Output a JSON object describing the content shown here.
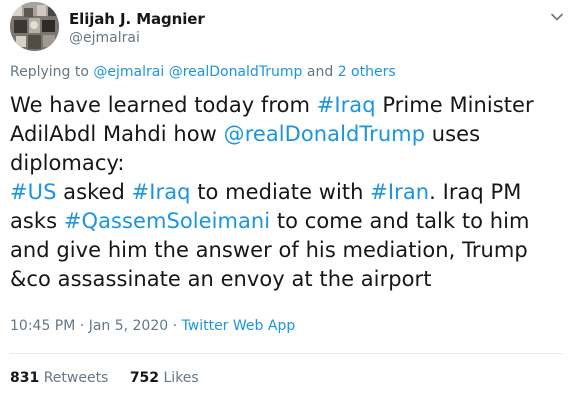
{
  "author": {
    "name": "Elijah J. Magnier",
    "handle": "@ejmalrai"
  },
  "reply_context": {
    "prefix": "Replying to",
    "mention_1": "@ejmalrai",
    "mention_2": "@realDonaldTrump",
    "joiner": "and",
    "others": "2 others"
  },
  "tweet": {
    "t1": "We have learned today from ",
    "h_iraq_1": "#Iraq",
    "t2": " Prime Minister AdilAbdl Mahdi how ",
    "m_trump": "@realDonaldTrump",
    "t3": " uses diplomacy:",
    "h_us": "#US",
    "t4": " asked ",
    "h_iraq_2": "#Iraq",
    "t5": " to mediate with ",
    "h_iran": "#Iran",
    "t6": ". Iraq PM asks ",
    "h_qassem": "#QassemSoleimani",
    "t7": " to come and talk to him and give him the answer of his mediation, Trump &co assassinate an envoy at the airport"
  },
  "meta": {
    "time": "10:45 PM",
    "sep": " · ",
    "date": "Jan 5, 2020",
    "app": "Twitter Web App"
  },
  "stats": {
    "retweets_count": "831",
    "retweets_label": "Retweets",
    "likes_count": "752",
    "likes_label": "Likes"
  },
  "icons": {
    "menu": "chevron-down-icon"
  },
  "colors": {
    "link": "#1b95e0",
    "secondary": "#657786",
    "text": "#14171a"
  }
}
